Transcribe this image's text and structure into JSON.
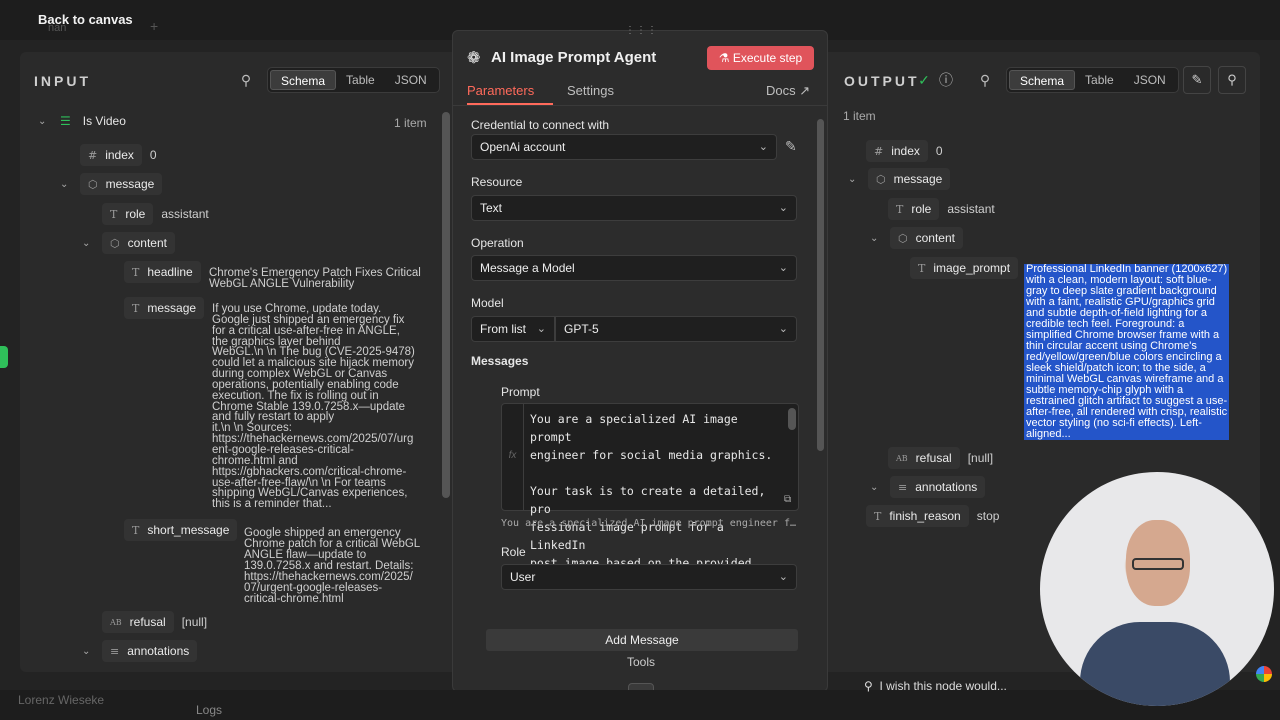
{
  "topbar": {
    "back_label": "Back to canvas",
    "ghost_text": "nan"
  },
  "input": {
    "title": "INPUT",
    "tabs": [
      "Schema",
      "Table",
      "JSON"
    ],
    "node_name": "Is Video",
    "item_count": "1 item",
    "index_key": "index",
    "index_val": "0",
    "message_key": "message",
    "role_key": "role",
    "role_val": "assistant",
    "content_key": "content",
    "headline_key": "headline",
    "headline_val": "Chrome's Emergency Patch Fixes Critical\nWebGL ANGLE Vulnerability",
    "msg_key": "message",
    "msg_val": "If you use Chrome, update today.\nGoogle just shipped an emergency fix\nfor a critical use-after-free in ANGLE,\nthe graphics layer behind\nWebGL.\\n \\n The bug (CVE-2025-9478)\ncould let a malicious site hijack memory\nduring complex WebGL or Canvas\noperations, potentially enabling code\nexecution. The fix is rolling out in\nChrome Stable 139.0.7258.x—update\nand fully restart to apply\nit.\\n \\n Sources:\nhttps://thehackernews.com/2025/07/urg\nent-google-releases-critical-\nchrome.html and\nhttps://gbhackers.com/critical-chrome-\nuse-after-free-flaw/\\n \\n For teams\nshipping WebGL/Canvas experiences,\nthis is a reminder that...",
    "short_key": "short_message",
    "short_val": "Google shipped an emergency\nChrome patch for a critical WebGL\nANGLE flaw—update to\n139.0.7258.x and restart. Details:\nhttps://thehackernews.com/2025/\n07/urgent-google-releases-\ncritical-chrome.html",
    "refusal_key": "refusal",
    "refusal_val": "[null]",
    "annotations_key": "annotations"
  },
  "modal": {
    "title": "AI Image Prompt Agent",
    "execute_label": "Execute step",
    "tab_parameters": "Parameters",
    "tab_settings": "Settings",
    "docs_label": "Docs",
    "credential_label": "Credential to connect with",
    "credential_value": "OpenAi account",
    "resource_label": "Resource",
    "resource_value": "Text",
    "operation_label": "Operation",
    "operation_value": "Message a Model",
    "model_label": "Model",
    "model_mode": "From list",
    "model_value": "GPT-5",
    "messages_label": "Messages",
    "prompt_label": "Prompt",
    "prompt_text": "You are a specialized AI image prompt\nengineer for social media graphics.\n\nYour task is to create a detailed, pro\nfessional image prompt for a LinkedIn\npost image based on the provided post",
    "prompt_preview": "You are a specialized AI image prompt engineer f…",
    "role_label": "Role",
    "role_value": "User",
    "add_message": "Add Message",
    "tools_label": "Tools"
  },
  "output": {
    "title": "OUTPUT",
    "tabs": [
      "Schema",
      "Table",
      "JSON"
    ],
    "item_count": "1 item",
    "index_key": "index",
    "index_val": "0",
    "message_key": "message",
    "role_key": "role",
    "role_val": "assistant",
    "content_key": "content",
    "image_prompt_key": "image_prompt",
    "image_prompt_val": "Professional LinkedIn banner (1200x627)\nwith a clean, modern layout: soft blue-\ngray to deep slate gradient background\nwith a faint, realistic GPU/graphics grid\nand subtle depth-of-field lighting for a\ncredible tech feel. Foreground: a\nsimplified Chrome browser frame with a\nthin circular accent using Chrome's\nred/yellow/green/blue colors encircling a\nsleek shield/patch icon; to the side, a\nminimal WebGL canvas wireframe and a\nsubtle memory-chip glyph with a\nrestrained glitch artifact to suggest a use-\nafter-free, all rendered with crisp, realistic\nvector styling (no sci-fi effects). Left-\naligned...",
    "refusal_key": "refusal",
    "refusal_val": "[null]",
    "annotations_key": "annotations",
    "finish_key": "finish_reason",
    "finish_val": "stop"
  },
  "footer": {
    "logs": "Logs",
    "wish": "I wish this node would...",
    "user": "Lorenz Wieseke"
  }
}
